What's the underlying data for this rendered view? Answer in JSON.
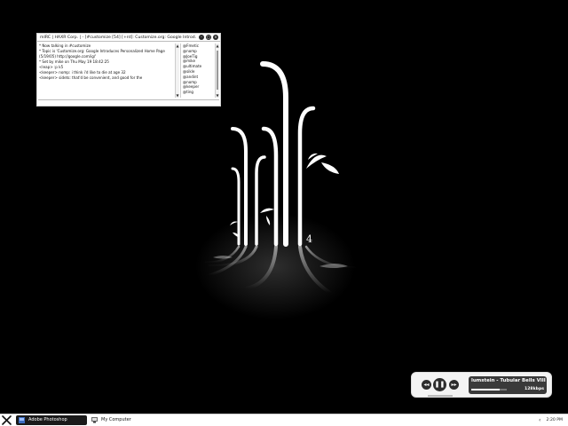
{
  "irc": {
    "title": "mIRC | HAXR Corp. | - [#customize [54] [+nt]: Customize.org: Google Introd...",
    "buttons": {
      "minimize": "–",
      "restore": "□",
      "close": "×"
    },
    "messages": [
      "* Now talking in #customize",
      "* Topic is 'Customize.org: Google Introduces Personalized Home Page",
      "(5/19/05) http://google.com/ig/'",
      "* Set by mike on Thu May 19 18:42:25",
      "<leap> :p k5",
      "<keeper> nomp: i think i'd like to die at age 32",
      "<keeper> sidets: that'd be convenient, and good for the"
    ],
    "nicks": [
      "@Fmetic",
      "@nomp",
      "@JoeTig",
      "@mike",
      "@ultimate",
      "@sikle",
      "@andint",
      "@nomp",
      "@keeper",
      "@ting"
    ]
  },
  "wallpaper": {
    "number_glyph": "4",
    "accent": "#ffffff",
    "background": "#000000"
  },
  "player": {
    "track": "lumstein - Tubular Bells VIII",
    "bitrate": "128kbps",
    "progress": 0.8,
    "buttons": {
      "prev": "◂◂",
      "play_pause": "❚❚",
      "next": "▸▸"
    }
  },
  "taskbar": {
    "items": [
      {
        "label": "Adobe Photoshop",
        "active": true,
        "icon": "photoshop-icon"
      },
      {
        "label": "My Computer",
        "active": false,
        "icon": "computer-icon"
      }
    ],
    "tray_arrow": "‹",
    "clock": "2:20 PM"
  }
}
